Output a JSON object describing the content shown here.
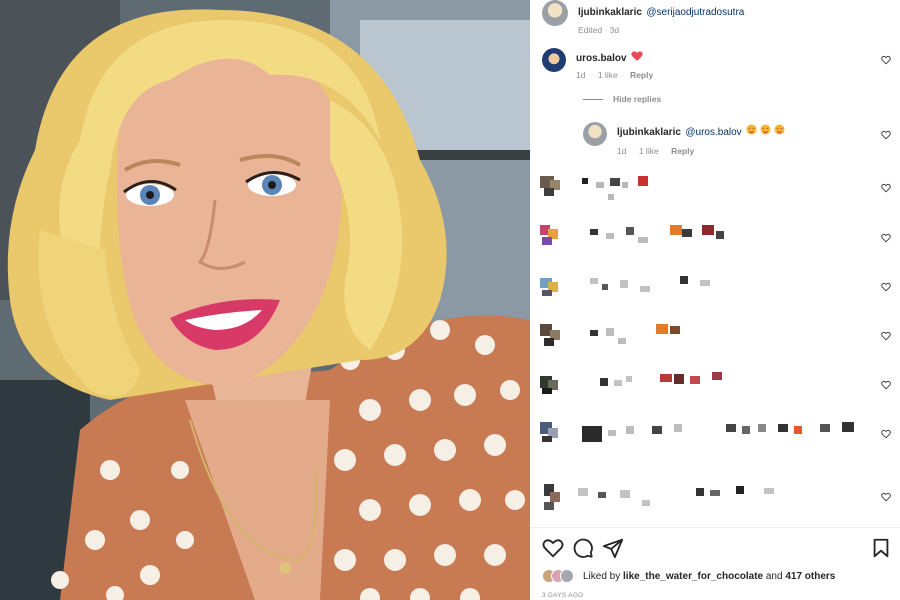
{
  "photo": {
    "subject": "selfie of a blonde woman in a polka-dot blouse",
    "colors": {
      "blouse": "#c87a52",
      "dots": "#f6efe6",
      "hair": "#f3db84",
      "background": "#6f7e88"
    }
  },
  "caption": {
    "username": "ljubinkaklaric",
    "mention": "@serijaodjutradosutra",
    "meta": "Edited · 3d"
  },
  "comments": [
    {
      "username": "uros.balov",
      "text": "",
      "emoji": "heart",
      "time": "1d",
      "likes": "1 like",
      "reply": "Reply"
    }
  ],
  "hide_replies": "Hide replies",
  "replies": [
    {
      "username": "ljubinkaklaric",
      "mention": "@uros.balov",
      "emoji": "star-struck ×3",
      "time": "1d",
      "likes": "1 like",
      "reply": "Reply"
    }
  ],
  "obscured_comments_count": 7,
  "actions": {
    "icons": [
      "heart-icon",
      "comment-icon",
      "share-icon",
      "bookmark-icon"
    ]
  },
  "likes": {
    "prefix": "Liked by",
    "first_user": "like_the_water_for_chocolate",
    "conjunction": "and",
    "others": "417 others"
  },
  "time_ago": "3 DAYS AGO",
  "colors": {
    "link": "#00376b",
    "muted": "#8e8e8e",
    "text": "#262626",
    "heart_red": "#ed4956"
  }
}
